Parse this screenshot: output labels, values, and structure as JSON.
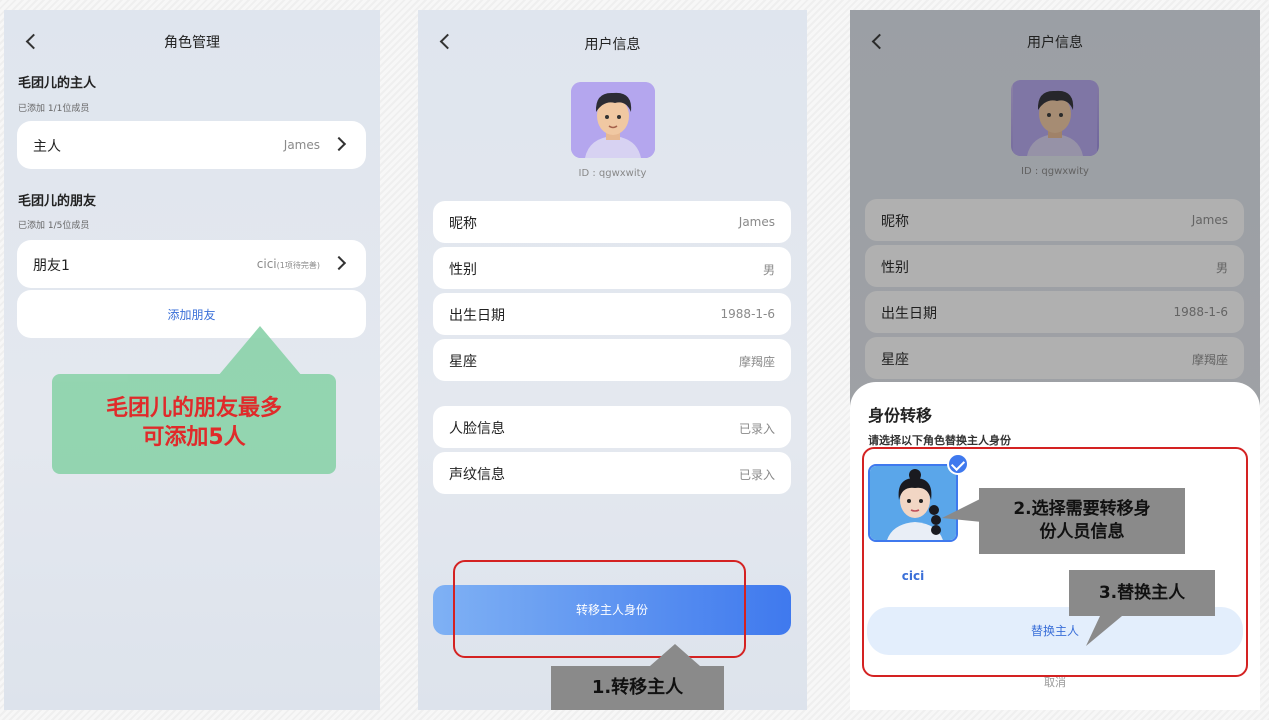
{
  "screen1": {
    "title": "角色管理",
    "owner_section": {
      "title": "毛团儿的主人",
      "sub": "已添加 1/1位成员",
      "row_label": "主人",
      "row_value": "James"
    },
    "friend_section": {
      "title": "毛团儿的朋友",
      "sub": "已添加 1/5位成员",
      "row_label": "朋友1",
      "row_value": "cici",
      "row_note": "(1项待完善)",
      "add_button": "添加朋友"
    },
    "callout": [
      "毛团儿的朋友最多",
      "可添加5人"
    ]
  },
  "screen2": {
    "title": "用户信息",
    "user_id": "ID : qgwxwity",
    "fields": [
      {
        "label": "昵称",
        "value": "James"
      },
      {
        "label": "性别",
        "value": "男"
      },
      {
        "label": "出生日期",
        "value": "1988-1-6"
      },
      {
        "label": "星座",
        "value": "摩羯座"
      }
    ],
    "bio_fields": [
      {
        "label": "人脸信息",
        "value": "已录入"
      },
      {
        "label": "声纹信息",
        "value": "已录入"
      }
    ],
    "transfer_button": "转移主人身份",
    "step_callout": "1.转移主人"
  },
  "screen3": {
    "title": "用户信息",
    "user_id": "ID : qgwxwity",
    "fields": [
      {
        "label": "昵称",
        "value": "James"
      },
      {
        "label": "性别",
        "value": "男"
      },
      {
        "label": "出生日期",
        "value": "1988-1-6"
      },
      {
        "label": "星座",
        "value": "摩羯座"
      }
    ],
    "sheet": {
      "title": "身份转移",
      "subtitle": "请选择以下角色替换主人身份",
      "candidate_name": "cici",
      "replace_button": "替换主人",
      "cancel": "取消"
    },
    "step2_callout": [
      "2.选择需要转移身",
      "份人员信息"
    ],
    "step3_callout": "3.替换主人"
  },
  "colors": {
    "accent": "#3f79ee",
    "highlight": "#d42222",
    "callout_green": "#8fd4ad",
    "callout_gray": "#8a8a8a"
  }
}
